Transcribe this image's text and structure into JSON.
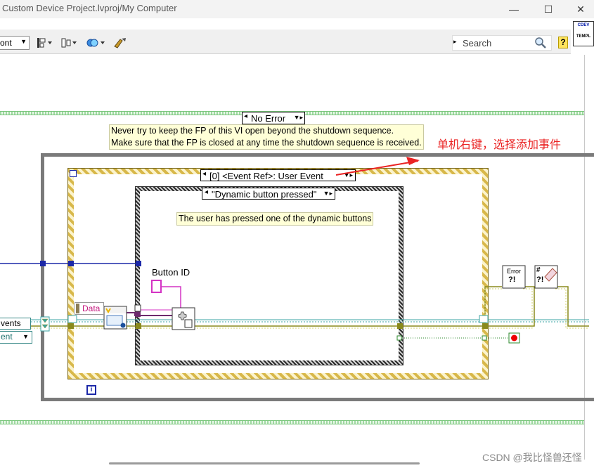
{
  "window": {
    "title": "Custom Device Project.lvproj/My Computer",
    "minimize_glyph": "—",
    "maximize_glyph": "☐",
    "close_glyph": "✕"
  },
  "toolbar": {
    "font_label": "ont",
    "search_placeholder": "Search",
    "help_glyph": "?",
    "vi_icon_tag": "CDEV",
    "vi_icon_label": "TEMPL"
  },
  "diagram": {
    "case_selector_value": "No Error",
    "shutdown_note_line1": "Never try to keep the FP of this VI open beyond the shutdown sequence.",
    "shutdown_note_line2": "Make sure that the FP is closed at any time the shutdown sequence is received.",
    "annotation": "单机右键，选择添加事件",
    "event_selector_value": "[0] <Event Ref>: User Event",
    "inner_case_value": "\"Dynamic button pressed\"",
    "inner_note": "The user has pressed one of the dynamic buttons",
    "button_id_label": "Button ID",
    "data_label": "Data",
    "events_control_text": "vents",
    "event_dropdown_text": "ent",
    "iteration_glyph": "i",
    "error_icon_text": "Error"
  },
  "footer": {
    "watermark": "CSDN @我比怪兽还怪"
  },
  "colors": {
    "annotation": "#ea2323",
    "wire_blue": "#1c28a8",
    "wire_olive": "#8a8a1c",
    "wire_teal": "#3aa3a3",
    "wire_pink": "#d433c4",
    "wire_green": "#2d8a2d"
  }
}
